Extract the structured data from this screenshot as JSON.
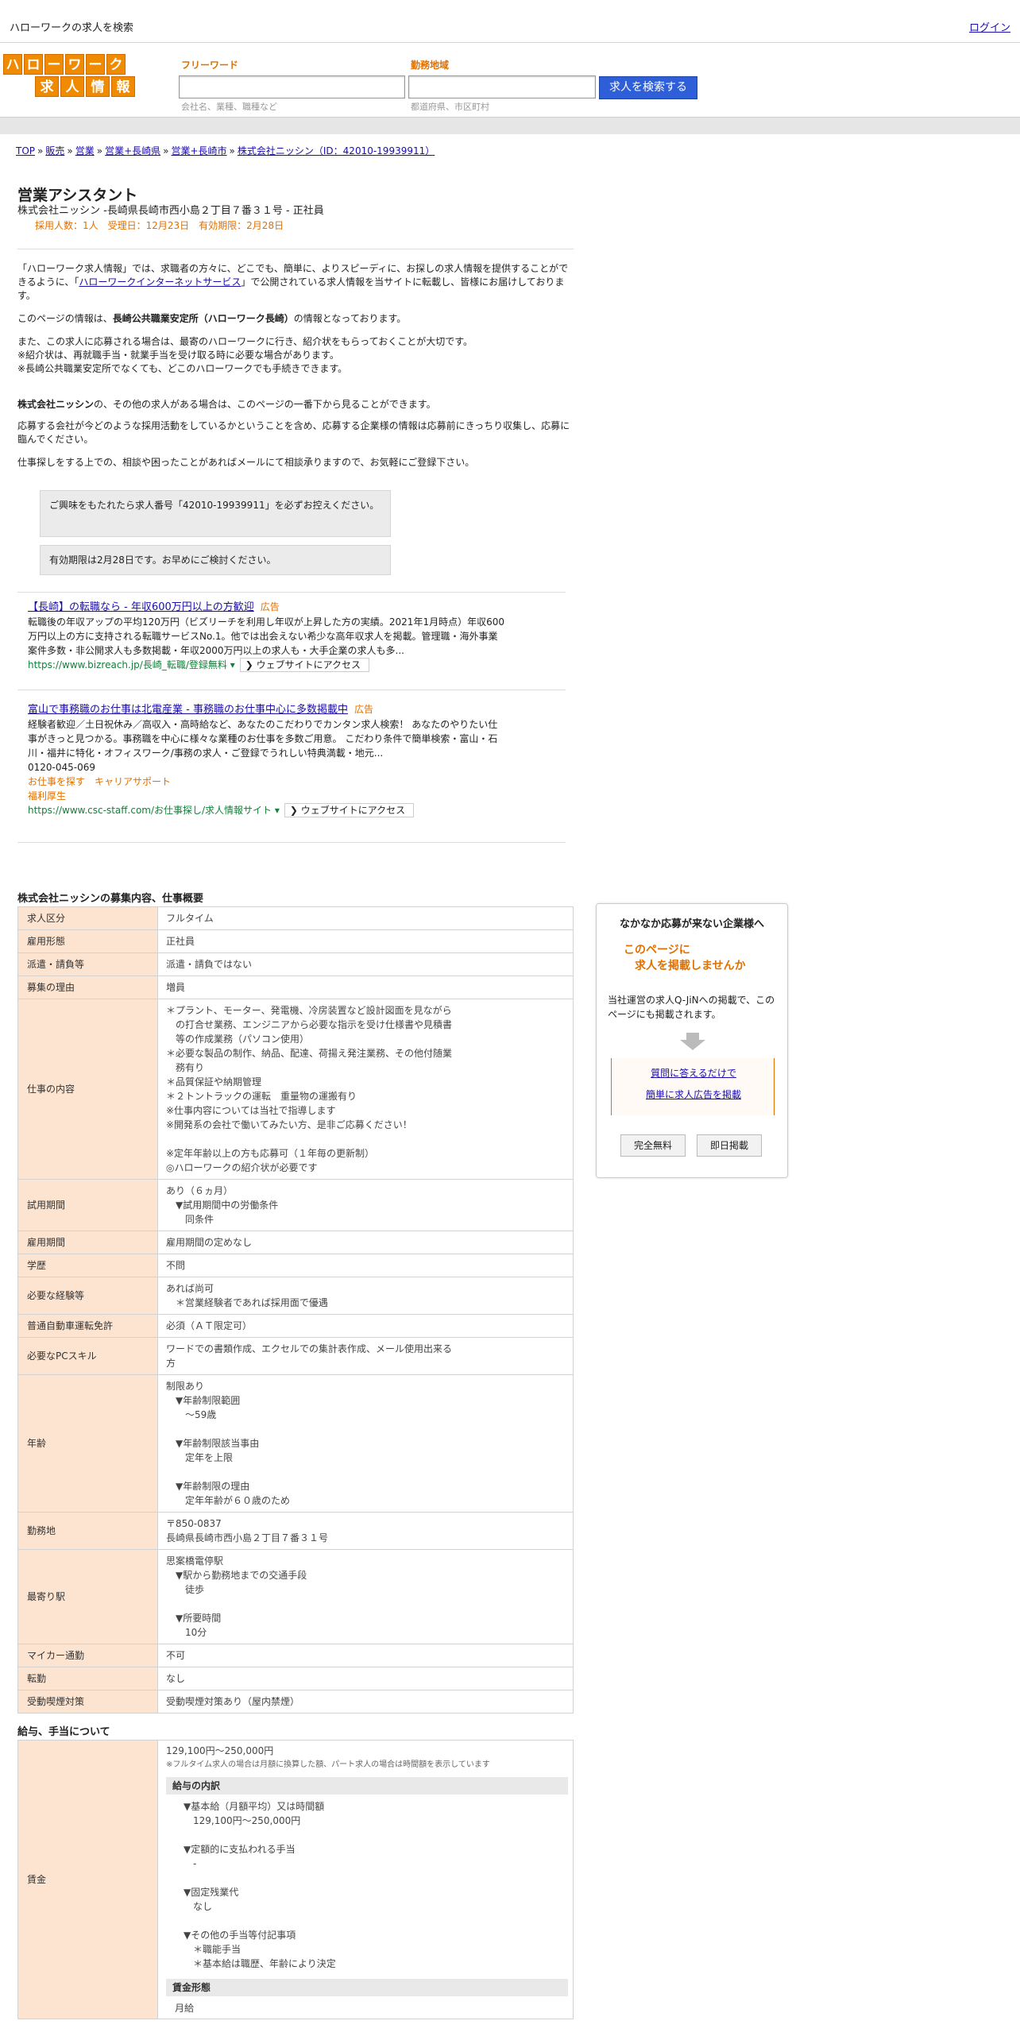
{
  "topbar": {
    "site_title": "ハローワークの求人を検索",
    "login": "ログイン"
  },
  "header": {
    "logo_row1": [
      "ハ",
      "ロ",
      "ー",
      "ワ",
      "ー",
      "ク"
    ],
    "logo_row2": [
      "求",
      "人",
      "情",
      "報"
    ],
    "freeword_label": "フリーワード",
    "freeword_placeholder": "会社名、業種、職種など",
    "area_label": "勤務地域",
    "area_placeholder": "都道府県、市区町村",
    "search_button": "求人を検索する"
  },
  "breadcrumb": [
    "TOP",
    "販売",
    "営業",
    "営業+長崎県",
    "営業+長崎市",
    "株式会社ニッシン（ID：42010-19939911）"
  ],
  "breadcrumb_sep": "»",
  "job": {
    "title": "営業アシスタント",
    "subtitle": "株式会社ニッシン -長崎県長崎市西小島２丁目７番３１号 - 正社員",
    "meta": "採用人数：1人　受理日：12月23日　有効期限：2月28日"
  },
  "intro": {
    "p1_pre": "「ハローワーク求人情報」では、求職者の方々に、どこでも、簡単に、よりスピーディに、お探しの求人情報を提供することができるように、「",
    "p1_link": "ハローワークインターネットサービス",
    "p1_post": "」で公開されている求人情報を当サイトに転載し、皆様にお届けしております。",
    "p2_pre": "このページの情報は、",
    "p2_bold": "長崎公共職業安定所（ハローワーク長崎）",
    "p2_post": "の情報となっております。",
    "p3": "また、この求人に応募される場合は、最寄のハローワークに行き、紹介状をもらっておくことが大切です。\n※紹介状は、再就職手当・就業手当を受け取る時に必要な場合があります。\n※長崎公共職業安定所でなくても、どこのハローワークでも手続きできます。",
    "p4_bold": "株式会社ニッシン",
    "p4_post": "の、その他の求人がある場合は、このページの一番下から見ることができます。",
    "p5": "応募する会社が今どのような採用活動をしているかということを含め、応募する企業様の情報は応募前にきっちり収集し、応募に臨んでください。",
    "p6": "仕事探しをする上での、相談や困ったことがあればメールにて相談承りますので、お気軽にご登録下さい。"
  },
  "notices": [
    "ご興味をもたれたら求人番号「42010-19939911」を必ずお控えください。",
    "有効期限は2月28日です。お早めにご検討ください。"
  ],
  "ads": [
    {
      "title": "【長崎】の転職なら - 年収600万円以上の方歓迎",
      "badge": "広告",
      "text": "転職後の年収アップの平均120万円（ビズリーチを利用し年収が上昇した方の実績。2021年1月時点）年収600万円以上の方に支持される転職サービスNo.1。他では出会えない希少な高年収求人を掲載。管理職・海外事業案件多数・非公開求人も多数掲載・年収2000万円以上の求人も・大手企業の求人も多...",
      "url": "https://www.bizreach.jp/長崎_転職/登録無料",
      "visit": "ウェブサイトにアクセス"
    },
    {
      "title": "富山で事務職のお仕事は北電産業 - 事務職のお仕事中心に多数掲載中",
      "badge": "広告",
      "text": "経験者歓迎／土日祝休み／高収入・高時給など、あなたのこだわりでカンタン求人検索！ あなたのやりたい仕事がきっと見つかる。事務職を中心に様々な業種のお仕事を多数ご用意。 こだわり条件で簡単検索・富山・石川・福井に特化・オフィスワーク/事務の求人・ご登録でうれしい特典満載・地元...",
      "phone": "0120-045-069",
      "links": [
        "お仕事を探す",
        "キャリアサポート",
        "福利厚生"
      ],
      "url": "https://www.csc-staff.com/お仕事探し/求人情報サイト",
      "visit": "ウェブサイトにアクセス"
    }
  ],
  "overview": {
    "title": "株式会社ニッシンの募集内容、仕事概要",
    "rows": [
      {
        "label": "求人区分",
        "value": "フルタイム"
      },
      {
        "label": "雇用形態",
        "value": "正社員"
      },
      {
        "label": "派遣・請負等",
        "value": "派遣・請負ではない"
      },
      {
        "label": "募集の理由",
        "value": "増員"
      },
      {
        "label": "仕事の内容",
        "value": "＊プラント、モーター、発電機、冷房装置など設計図面を見ながら\n　の打合せ業務、エンジニアから必要な指示を受け仕様書や見積書\n　等の作成業務（パソコン使用）\n＊必要な製品の制作、納品、配達、荷揚え発注業務、その他付随業\n　務有り\n＊品質保証や納期管理\n＊２トントラックの運転　重量物の運搬有り\n※仕事内容については当社で指導します\n※開発系の会社で働いてみたい方、是非ご応募ください！\n\n※定年年齢以上の方も応募可（１年毎の更新制）\n◎ハローワークの紹介状が必要です"
      },
      {
        "label": "試用期間",
        "value": "あり（６ヵ月）\n　▼試用期間中の労働条件\n　　同条件"
      },
      {
        "label": "雇用期間",
        "value": "雇用期間の定めなし"
      },
      {
        "label": "学歴",
        "value": "不問"
      },
      {
        "label": "必要な経験等",
        "value": "あれば尚可\n　＊営業経験者であれば採用面で優遇"
      },
      {
        "label": "普通自動車運転免許",
        "value": "必須（ＡＴ限定可）"
      },
      {
        "label": "必要なPCスキル",
        "value": "ワードでの書類作成、エクセルでの集計表作成、メール使用出来る\n方"
      },
      {
        "label": "年齢",
        "value": "制限あり\n　▼年齢制限範囲\n　　〜59歳\n\n　▼年齢制限該当事由\n　　定年を上限\n\n　▼年齢制限の理由\n　　定年年齢が６０歳のため"
      },
      {
        "label": "勤務地",
        "value": "〒850-0837\n長崎県長崎市西小島２丁目７番３１号"
      },
      {
        "label": "最寄り駅",
        "value": "思案橋電停駅\n　▼駅から勤務地までの交通手段\n　　徒歩\n\n　▼所要時間\n　　10分"
      },
      {
        "label": "マイカー通勤",
        "value": "不可"
      },
      {
        "label": "転勤",
        "value": "なし"
      },
      {
        "label": "受動喫煙対策",
        "value": "受動喫煙対策あり（屋内禁煙）"
      }
    ]
  },
  "salary": {
    "title": "給与、手当について",
    "label": "賃金",
    "range": "129,100円〜250,000円",
    "note": "※フルタイム求人の場合は月額に換算した額、パート求人の場合は時間額を表示しています",
    "breakdown_head": "給与の内訳",
    "breakdown": "▼基本給（月額平均）又は時間額\n　129,100円〜250,000円\n\n▼定額的に支払われる手当\n　-\n\n▼固定残業代\n　なし\n\n▼その他の手当等付記事項\n　＊職能手当\n　＊基本給は職歴、年齢により決定",
    "form_head": "賃金形態",
    "form_value": "月給"
  },
  "sidebar": {
    "title": "なかなか応募が来ない企業様へ",
    "headline": "このページに\n　求人を掲載しませんか",
    "desc": "当社運営の求人Q-JiNへの掲載で、このページにも掲載されます。",
    "link1": "質問に答えるだけで",
    "link2": "簡単に求人広告を掲載",
    "btn1": "完全無料",
    "btn2": "即日掲載"
  },
  "colors": {
    "accent": "#e07000",
    "logo": "#f08a00",
    "search_btn": "#2f5fd8",
    "table_head": "#fde4d0",
    "link": "#1a0dab",
    "ad_url": "#13803a"
  }
}
